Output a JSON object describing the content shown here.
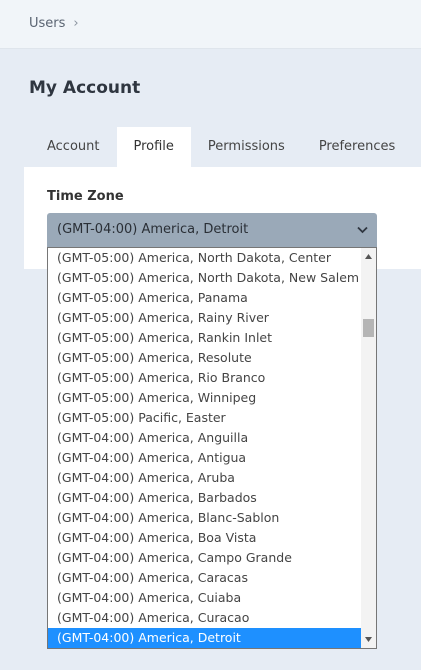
{
  "breadcrumb": {
    "item": "Users",
    "separator": "›"
  },
  "page_title": "My Account",
  "tabs": [
    {
      "label": "Account",
      "active": false
    },
    {
      "label": "Profile",
      "active": true
    },
    {
      "label": "Permissions",
      "active": false
    },
    {
      "label": "Preferences",
      "active": false
    }
  ],
  "timezone": {
    "label": "Time Zone",
    "selected": "(GMT-04:00) America, Detroit",
    "chevron_icon": "chevron-down-icon",
    "options": [
      "(GMT-05:00) America, North Dakota, Center",
      "(GMT-05:00) America, North Dakota, New Salem",
      "(GMT-05:00) America, Panama",
      "(GMT-05:00) America, Rainy River",
      "(GMT-05:00) America, Rankin Inlet",
      "(GMT-05:00) America, Resolute",
      "(GMT-05:00) America, Rio Branco",
      "(GMT-05:00) America, Winnipeg",
      "(GMT-05:00) Pacific, Easter",
      "(GMT-04:00) America, Anguilla",
      "(GMT-04:00) America, Antigua",
      "(GMT-04:00) America, Aruba",
      "(GMT-04:00) America, Barbados",
      "(GMT-04:00) America, Blanc-Sablon",
      "(GMT-04:00) America, Boa Vista",
      "(GMT-04:00) America, Campo Grande",
      "(GMT-04:00) America, Caracas",
      "(GMT-04:00) America, Cuiaba",
      "(GMT-04:00) America, Curacao",
      "(GMT-04:00) America, Detroit"
    ],
    "selected_index": 19
  },
  "colors": {
    "page_bg": "#e6ecf4",
    "select_bg": "#9aa9b8",
    "highlight": "#1e90ff"
  }
}
